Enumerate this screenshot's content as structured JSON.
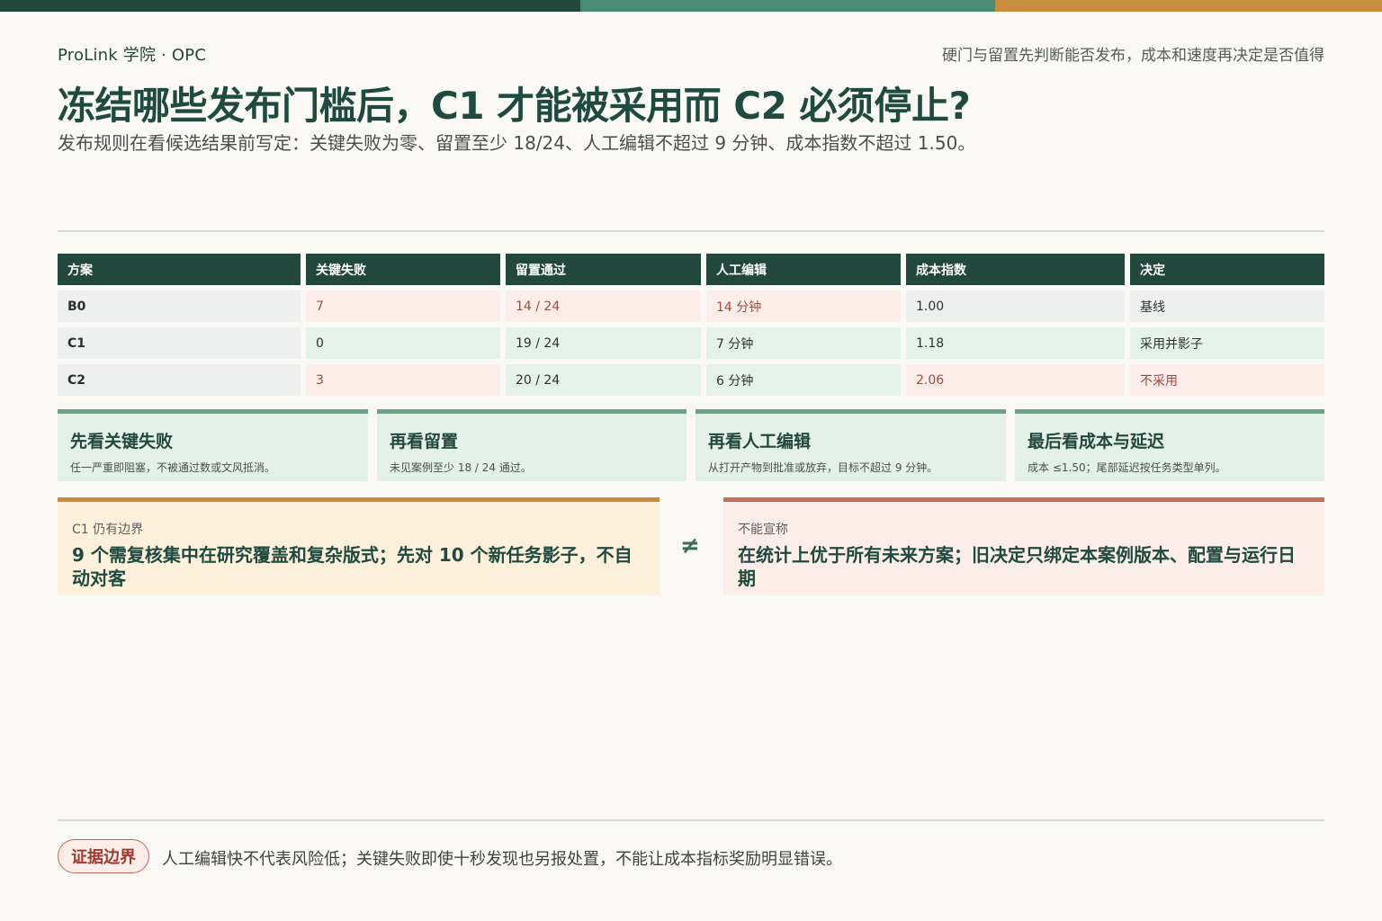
{
  "header": {
    "brand": "ProLink 学院 · OPC",
    "tagline": "硬门与留置先判断能否发布，成本和速度再决定是否值得",
    "title": "冻结哪些发布门槛后，C1 才能被采用而 C2 必须停止?",
    "subtitle": "发布规则在看候选结果前写定：关键失败为零、留置至少 18/24、人工编辑不超过 9 分钟、成本指数不超过 1.50。"
  },
  "colors": {
    "dark_green": "#22473d",
    "mid_green": "#4a8b77",
    "orange": "#c98d3e",
    "red": "#c76e61"
  },
  "table": {
    "headers": [
      "方案",
      "关键失败",
      "留置通过",
      "人工编辑",
      "成本指数",
      "决定"
    ],
    "rows": [
      {
        "label": "B0",
        "cells": [
          {
            "text": "7",
            "status": "r"
          },
          {
            "text": "14 / 24",
            "status": "r"
          },
          {
            "text": "14 分钟",
            "status": "r"
          },
          {
            "text": "1.00",
            "status": "n"
          },
          {
            "text": "基线",
            "status": "n"
          }
        ]
      },
      {
        "label": "C1",
        "cells": [
          {
            "text": "0",
            "status": "g"
          },
          {
            "text": "19 / 24",
            "status": "g"
          },
          {
            "text": "7 分钟",
            "status": "g"
          },
          {
            "text": "1.18",
            "status": "g"
          },
          {
            "text": "采用并影子",
            "status": "g"
          }
        ]
      },
      {
        "label": "C2",
        "cells": [
          {
            "text": "3",
            "status": "r"
          },
          {
            "text": "20 / 24",
            "status": "g"
          },
          {
            "text": "6 分钟",
            "status": "g"
          },
          {
            "text": "2.06",
            "status": "r"
          },
          {
            "text": "不采用",
            "status": "r"
          }
        ]
      }
    ]
  },
  "steps": [
    {
      "title": "先看关键失败",
      "desc": "任一严重即阻塞，不被通过数或文风抵消。"
    },
    {
      "title": "再看留置",
      "desc": "未见案例至少 18 / 24 通过。"
    },
    {
      "title": "再看人工编辑",
      "desc": "从打开产物到批准或放弃，目标不超过 9 分钟。"
    },
    {
      "title": "最后看成本与延迟",
      "desc": "成本 ≤1.50；尾部延迟按任务类型单列。"
    }
  ],
  "boundary_left": {
    "label": "C1 仍有边界",
    "text": "9 个需复核集中在研究覆盖和复杂版式；先对 10 个新任务影子，不自动对客"
  },
  "neq_symbol": "≠",
  "boundary_right": {
    "label": "不能宣称",
    "text": "在统计上优于所有未来方案；旧决定只绑定本案例版本、配置与运行日期"
  },
  "footer": {
    "pill": "证据边界",
    "note": "人工编辑快不代表风险低；关键失败即使十秒发现也另报处置，不能让成本指标奖励明显错误。"
  }
}
